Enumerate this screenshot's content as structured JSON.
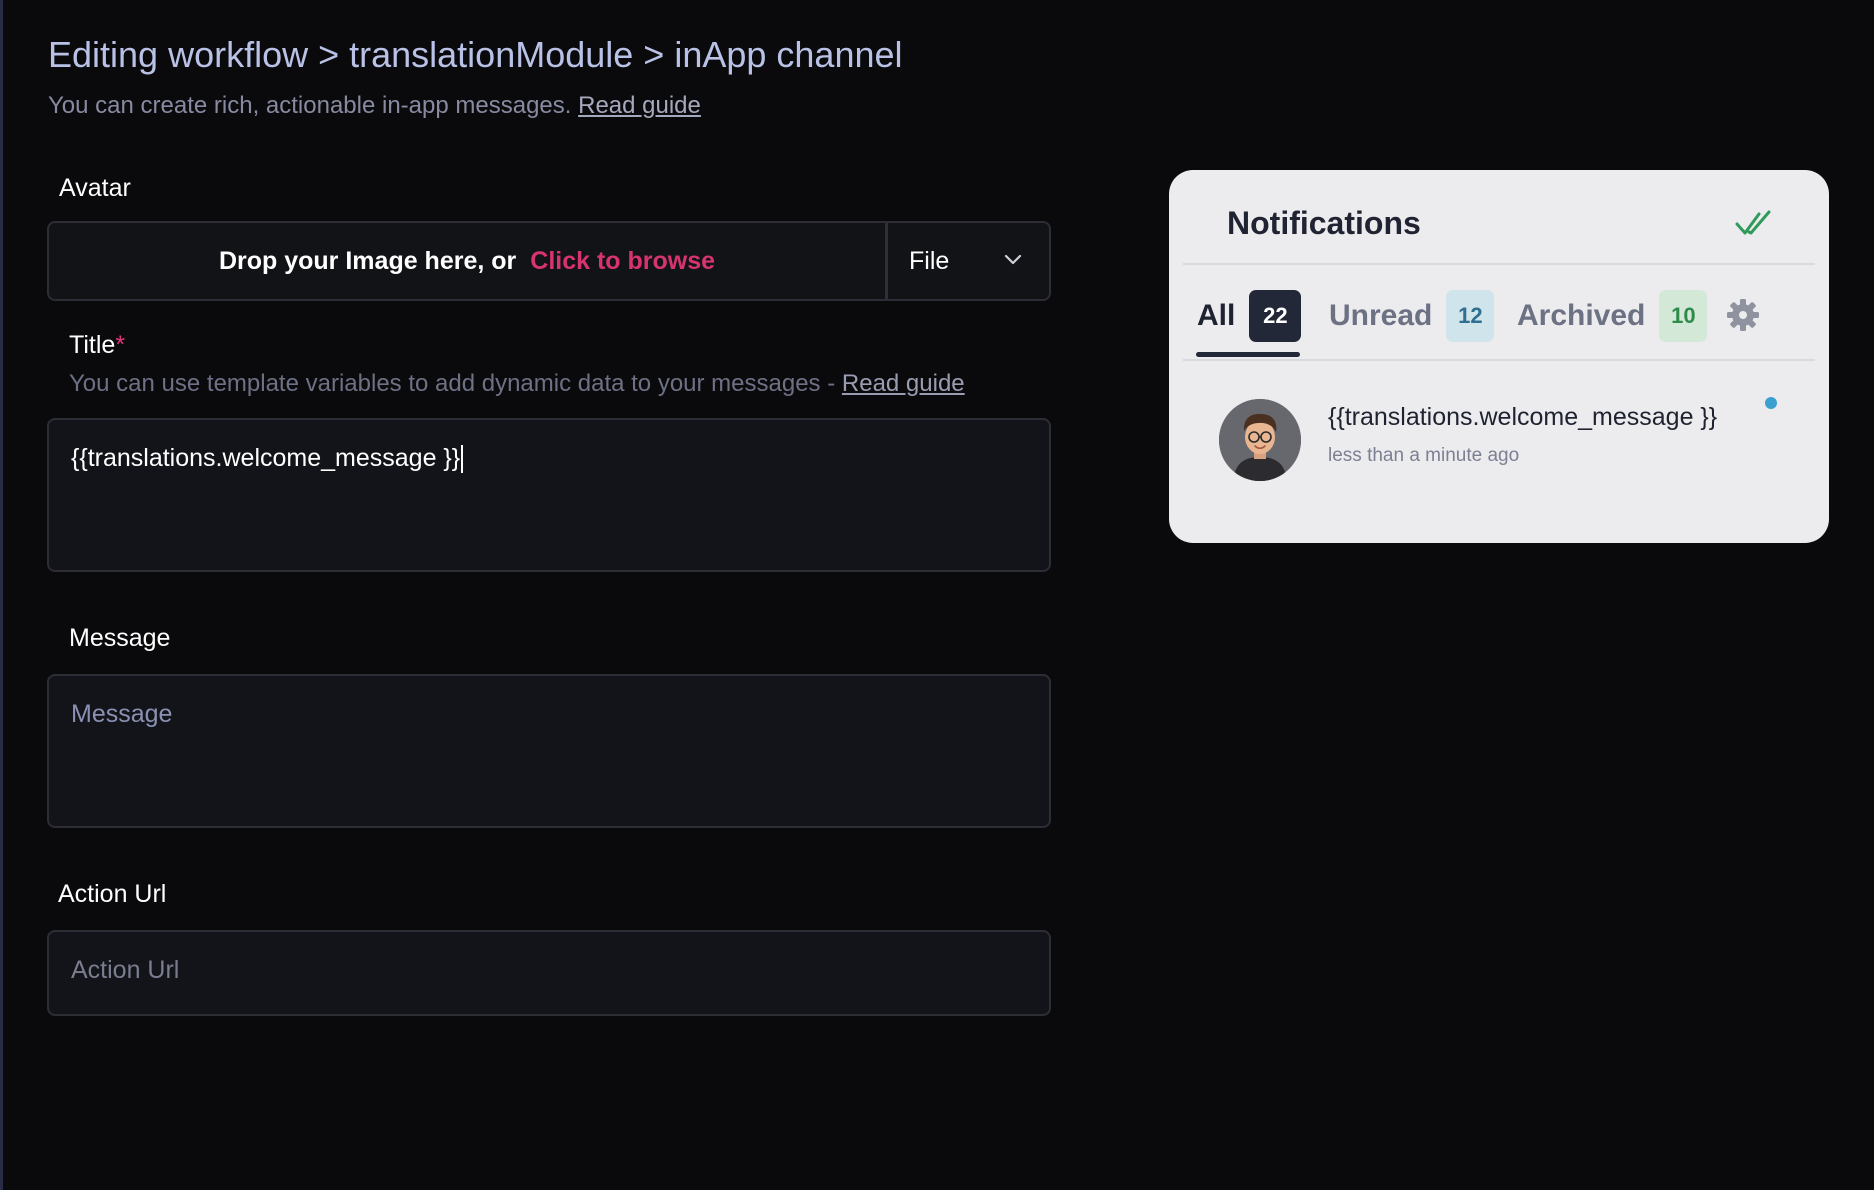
{
  "header": {
    "title": "Editing workflow > translationModule > inApp channel",
    "subtitle": "You can create rich, actionable in-app messages.",
    "subtitle_link": "Read guide"
  },
  "avatar_field": {
    "label": "Avatar",
    "drop_text": "Drop your Image here, or",
    "browse_link": "Click to browse",
    "source_select": "File"
  },
  "title_field": {
    "label": "Title",
    "required_mark": "*",
    "hint": "You can use template variables to add dynamic data to your messages -",
    "hint_link": "Read guide",
    "value": "{{translations.welcome_message }}"
  },
  "message_field": {
    "label": "Message",
    "placeholder": "Message"
  },
  "action_url_field": {
    "label": "Action Url",
    "placeholder": "Action Url"
  },
  "preview": {
    "title": "Notifications",
    "tabs": [
      {
        "label": "All",
        "count": "22"
      },
      {
        "label": "Unread",
        "count": "12"
      },
      {
        "label": "Archived",
        "count": "10"
      }
    ],
    "notification": {
      "message": "{{translations.welcome_message }}",
      "time": "less than a minute ago"
    },
    "colors": {
      "accent_link": "#d6336f",
      "unread_dot": "#3aa0d0",
      "mark_read_check": "#2f9a5a"
    },
    "icons": [
      "double-check-icon",
      "gear-icon",
      "chevron-down-icon"
    ]
  }
}
